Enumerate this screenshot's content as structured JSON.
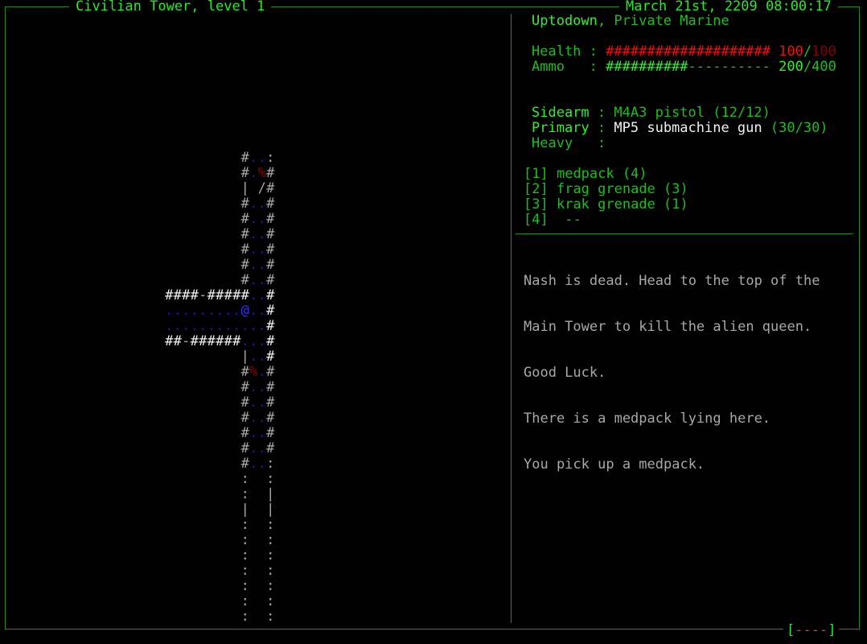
{
  "header": {
    "level_title": "Civilian Tower, level 1",
    "datetime": "March 21st, 2209 08:00:17"
  },
  "player": {
    "name": "Uptodown",
    "sep": ",",
    "rank": "Private Marine"
  },
  "stats": {
    "health": {
      "label": "Health",
      "colon": ":",
      "bar": "####################",
      "current": "100",
      "slash": "/",
      "max": "100"
    },
    "ammo": {
      "label": "Ammo",
      "colon": ":",
      "bar_full": "##########",
      "bar_empty": "----------",
      "current": "200",
      "slash": "/",
      "max": "400"
    }
  },
  "weapons": {
    "sidearm": {
      "label": "Sidearm",
      "colon": ":",
      "name": "M4A3 pistol",
      "ammo": "(12/12)"
    },
    "primary": {
      "label": "Primary",
      "colon": ":",
      "name": "MP5 submachine gun",
      "ammo": "(30/30)"
    },
    "heavy": {
      "label": "Heavy",
      "colon": ":"
    }
  },
  "inventory": [
    {
      "slot": "[1]",
      "item": "medpack",
      "count": "(4)"
    },
    {
      "slot": "[2]",
      "item": "frag grenade",
      "count": "(3)"
    },
    {
      "slot": "[3]",
      "item": "krak grenade",
      "count": "(1)"
    },
    {
      "slot": "[4]",
      "item": "--",
      "count": ""
    }
  ],
  "messages": [
    "Nash is dead. Head to the top of the",
    "Main Tower to kill the alien queen.",
    "Good Luck.",
    "There is a medpack lying here.",
    "You pick up a medpack."
  ],
  "footer": {
    "open": "[",
    "bar": "----",
    "close": "]"
  },
  "colors": {
    "border": "#1f8a1f",
    "green": "#22bb22",
    "bright_green": "#33ee33",
    "red": "#ee1111",
    "player": "#3333ff",
    "floor": "#1a1ab0",
    "wall": "#a8a8a8"
  },
  "map_rows": [
    "         #..:",
    "         #.%#",
    "         | /#",
    "         #..#",
    "         #..#",
    "         #..#",
    "         #..#",
    "         #..#",
    "         #..#",
    "####-#####..#",
    ".........@..#",
    "............#",
    "##-######...#",
    "         |..#",
    "         #%.#",
    "         #..#",
    "         #..#",
    "         #..#",
    "         #..#",
    "         #..#",
    "         #..:",
    "         :  :",
    "         :  |",
    "         |  |",
    "         :  :",
    "         :  :",
    "         :  :",
    "         :  :",
    "         :  :",
    "         :  :",
    "         :  :"
  ]
}
